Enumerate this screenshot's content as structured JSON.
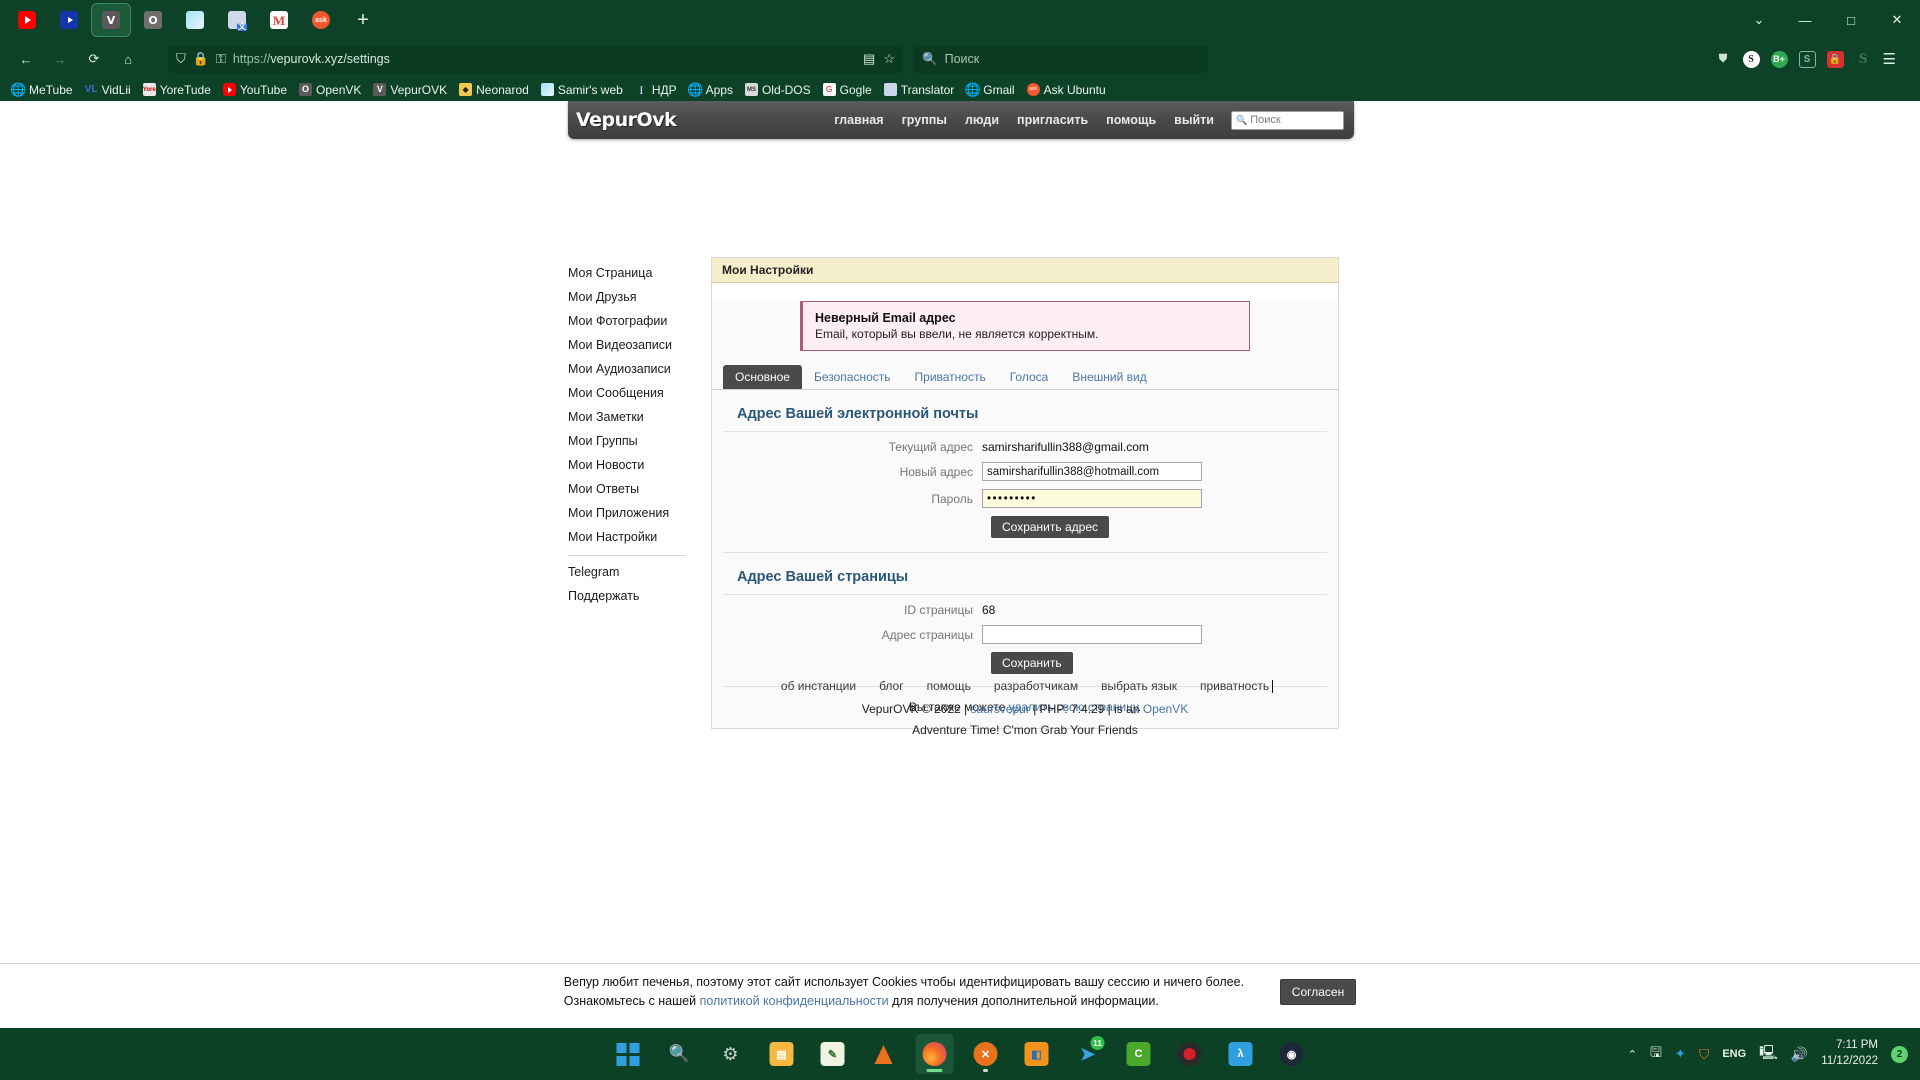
{
  "browser": {
    "tabs": [
      {
        "name": "youtube-tab",
        "icon": "youtube-icon",
        "active": false
      },
      {
        "name": "vidlii-tab",
        "icon": "blue-play-icon",
        "active": false
      },
      {
        "name": "vepurovk-tab",
        "icon": "vepurovk-icon",
        "active": true
      },
      {
        "name": "openvk-tab",
        "icon": "openvk-icon",
        "active": false
      },
      {
        "name": "image-tab",
        "icon": "picture-icon",
        "active": false
      },
      {
        "name": "translator-tab",
        "icon": "translator-icon",
        "active": false
      },
      {
        "name": "gmail-tab",
        "icon": "gmail-icon",
        "active": false
      },
      {
        "name": "askubuntu-tab",
        "icon": "ask-icon",
        "active": false
      }
    ],
    "newtab_label": "+",
    "window_controls": {
      "chevron": "⌄",
      "minimize": "—",
      "maximize": "□",
      "close": "✕"
    },
    "url": {
      "scheme": "https://",
      "host_path": "vepurovk.xyz/settings"
    },
    "search_placeholder": "Поиск",
    "bookmarks": [
      {
        "label": "MeTube",
        "icon": "globe-icon"
      },
      {
        "label": "VidLii",
        "icon": "vidlii-icon"
      },
      {
        "label": "YoreTude",
        "icon": "yoretube-icon"
      },
      {
        "label": "YouTube",
        "icon": "youtube-icon"
      },
      {
        "label": "OpenVK",
        "icon": "openvk-icon"
      },
      {
        "label": "VepurOVK",
        "icon": "vepurovk-icon"
      },
      {
        "label": "Neonarod",
        "icon": "neonarod-icon"
      },
      {
        "label": "Samir's web",
        "icon": "picture-icon"
      },
      {
        "label": "НДР",
        "icon": "ndr-icon"
      },
      {
        "label": "Apps",
        "icon": "globe-icon"
      },
      {
        "label": "Old-DOS",
        "icon": "olddos-icon"
      },
      {
        "label": "Gogle",
        "icon": "google-icon"
      },
      {
        "label": "Translator",
        "icon": "translator-icon"
      },
      {
        "label": "Gmail",
        "icon": "globe-icon"
      },
      {
        "label": "Ask Ubuntu",
        "icon": "ask-icon"
      }
    ]
  },
  "site": {
    "logo": "VepurOvk",
    "nav": [
      "главная",
      "группы",
      "люди",
      "пригласить",
      "помощь",
      "выйти"
    ],
    "header_search_placeholder": "Поиск",
    "page_title": "Мои Настройки",
    "error": {
      "title": "Неверный Email адрес",
      "description": "Email, который вы ввели, не является корректным."
    },
    "tabs": [
      {
        "label": "Основное",
        "active": true
      },
      {
        "label": "Безопасность",
        "active": false
      },
      {
        "label": "Приватность",
        "active": false
      },
      {
        "label": "Голоса",
        "active": false
      },
      {
        "label": "Внешний вид",
        "active": false
      }
    ],
    "email_section": {
      "heading": "Адрес Вашей электронной почты",
      "current_label": "Текущий адрес",
      "current_value": "samirsharifullin388@gmail.com",
      "new_label": "Новый адрес",
      "new_value": "samirsharifullin388@hotmaill.com",
      "password_label": "Пароль",
      "password_value": "•••••••••",
      "save_button": "Сохранить адрес"
    },
    "page_section": {
      "heading": "Адрес Вашей страницы",
      "id_label": "ID страницы",
      "id_value": "68",
      "address_label": "Адрес страницы",
      "address_value": "",
      "save_button": "Сохранить"
    },
    "delete_prefix": "Вы также можете ",
    "delete_link": "удалить свою страницу",
    "delete_suffix": ".",
    "sidebar": [
      "Моя Страница",
      "Мои Друзья",
      "Мои Фотографии",
      "Мои Видеозаписи",
      "Мои Аудиозаписи",
      "Мои Сообщения",
      "Мои Заметки",
      "Мои Группы",
      "Мои Новости",
      "Мои Ответы",
      "Мои Приложения",
      "Мои Настройки"
    ],
    "sidebar_extra": [
      "Telegram",
      "Поддержать"
    ],
    "footer": {
      "links": [
        "об инстанции",
        "блог",
        "помощь",
        "разработчикам",
        "выбрать язык",
        "приватность"
      ],
      "copyright_pre": "VepurOVK © 2022 | ",
      "copyright_author": "saursvepur",
      "copyright_mid": " | PHP: 7.4.29 | is an ",
      "copyright_engine": "OpenVK",
      "slogan": "Adventure Time! C'mon Grab Your Friends"
    },
    "cookie": {
      "text_1": "Вепур любит печенья, поэтому этот сайт использует Cookies чтобы идентифицировать вашу сессию и ничего более. Ознакомьтесь с нашей ",
      "link": "политикой конфиденциальности",
      "text_2": " для получения дополнительной информации.",
      "button": "Согласен"
    }
  },
  "taskbar": {
    "items": [
      {
        "name": "start-button",
        "icon": "windows-icon"
      },
      {
        "name": "search-taskbar",
        "icon": "search-icon"
      },
      {
        "name": "settings-taskbar",
        "icon": "gear-icon"
      },
      {
        "name": "file-explorer",
        "icon": "folder-icon"
      },
      {
        "name": "notepad-app",
        "icon": "notepad-icon"
      },
      {
        "name": "vlc-app",
        "icon": "vlc-cone-icon"
      },
      {
        "name": "firefox-app",
        "icon": "firefox-icon"
      },
      {
        "name": "app-x",
        "icon": "x-circle-icon"
      },
      {
        "name": "vmware-app",
        "icon": "vmware-icon"
      },
      {
        "name": "telegram-app",
        "icon": "telegram-icon",
        "badge": "11"
      },
      {
        "name": "app-c",
        "icon": "c-letter-icon"
      },
      {
        "name": "recorder-app",
        "icon": "record-icon"
      },
      {
        "name": "lambda-app",
        "icon": "lambda-icon"
      },
      {
        "name": "steam-app",
        "icon": "steam-icon"
      }
    ],
    "tray": {
      "chevron": "⌃",
      "usb": "usb-icon",
      "bluetooth": "bluetooth-icon",
      "shield": "shield-icon",
      "language": "ENG",
      "network": "network-icon",
      "volume": "volume-icon",
      "time": "7:11 PM",
      "date": "11/12/2022",
      "notifications": "2"
    }
  }
}
